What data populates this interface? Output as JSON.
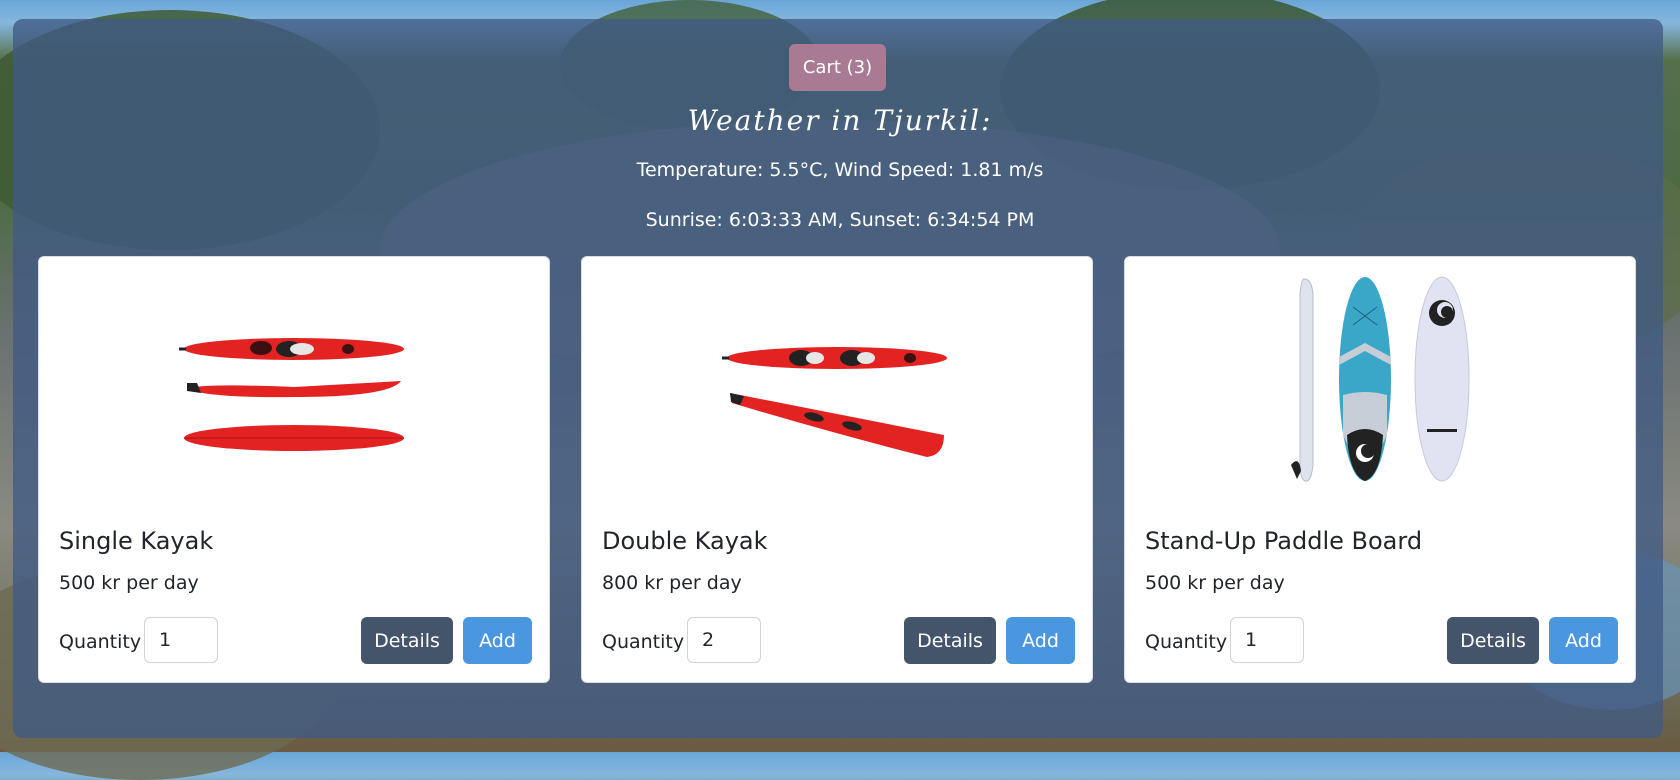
{
  "cart": {
    "label": "Cart (3)"
  },
  "weather": {
    "title": "Weather in Tjurkil:",
    "conditions": "Temperature: 5.5°C, Wind Speed: 1.81 m/s",
    "sun": "Sunrise: 6:03:33 AM, Sunset: 6:34:54 PM"
  },
  "colors": {
    "panel": "#405a84",
    "cart_button": "#a97b92",
    "details_button": "#44546a",
    "add_button": "#4a97e0",
    "kayak_red": "#e32222",
    "board_blue": "#3aa7c9"
  },
  "products": [
    {
      "name": "Single Kayak",
      "price": "500 kr per day",
      "quantity_label": "Quantity",
      "quantity": "1",
      "details_label": "Details",
      "add_label": "Add",
      "image_icon": "single-kayak-image"
    },
    {
      "name": "Double Kayak",
      "price": "800 kr per day",
      "quantity_label": "Quantity",
      "quantity": "2",
      "details_label": "Details",
      "add_label": "Add",
      "image_icon": "double-kayak-image"
    },
    {
      "name": "Stand-Up Paddle Board",
      "price": "500 kr per day",
      "quantity_label": "Quantity",
      "quantity": "1",
      "details_label": "Details",
      "add_label": "Add",
      "image_icon": "paddle-board-image"
    }
  ]
}
